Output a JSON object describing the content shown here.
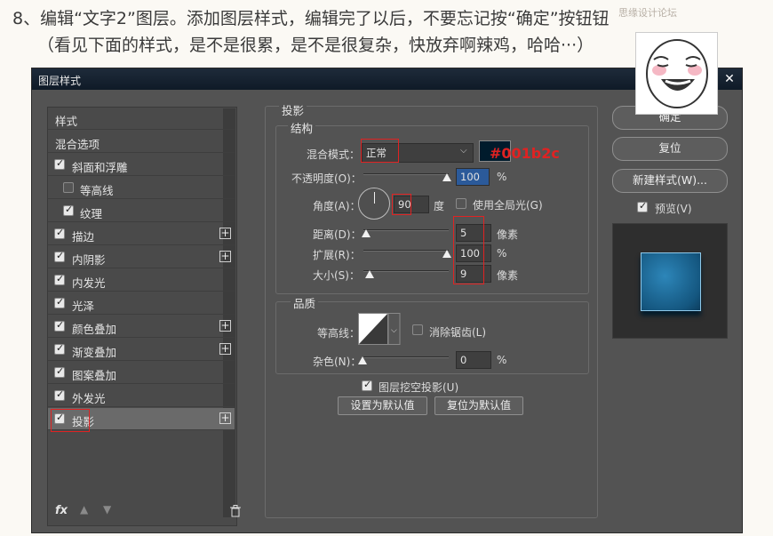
{
  "caption": {
    "line1": "8、编辑“文字2”图层。添加图层样式，编辑完了以后，不要忘记按“确定”按钮钮",
    "line2": "（看见下面的样式，是不是很累，是不是很复杂，快放弃啊辣鸡，哈哈···）",
    "watermark": "思缘设计论坛"
  },
  "dialog": {
    "title": "图层样式"
  },
  "styles_list": {
    "header": "样式",
    "blend_options": "混合选项",
    "items": [
      {
        "label": "斜面和浮雕",
        "checked": true
      },
      {
        "label": "等高线",
        "checked": false
      },
      {
        "label": "纹理",
        "checked": true
      },
      {
        "label": "描边",
        "checked": true
      },
      {
        "label": "内阴影",
        "checked": true
      },
      {
        "label": "内发光",
        "checked": true
      },
      {
        "label": "光泽",
        "checked": true
      },
      {
        "label": "颜色叠加",
        "checked": true
      },
      {
        "label": "渐变叠加",
        "checked": true
      },
      {
        "label": "图案叠加",
        "checked": true
      },
      {
        "label": "外发光",
        "checked": true
      },
      {
        "label": "投影",
        "checked": true
      }
    ],
    "fx_label": "fx"
  },
  "drop_shadow": {
    "title": "投影",
    "structure": "结构",
    "blend_mode_label": "混合模式：",
    "blend_mode_value": "正常",
    "color_annotation": "#001b2c",
    "color_hex": "#001b2c",
    "opacity_label": "不透明度(O)：",
    "opacity_value": "100",
    "opacity_unit": "%",
    "angle_label": "角度(A)：",
    "angle_value": "90",
    "angle_unit": "度",
    "global_light_label": "使用全局光(G)",
    "distance_label": "距离(D)：",
    "distance_value": "5",
    "distance_unit": "像素",
    "spread_label": "扩展(R)：",
    "spread_value": "100",
    "spread_unit": "%",
    "size_label": "大小(S)：",
    "size_value": "9",
    "size_unit": "像素",
    "quality": "品质",
    "contour_label": "等高线：",
    "antialias_label": "消除锯齿(L)",
    "noise_label": "杂色(N)：",
    "noise_value": "0",
    "noise_unit": "%",
    "knockout_label": "图层挖空投影(U)",
    "set_default": "设置为默认值",
    "reset_default": "复位为默认值"
  },
  "right": {
    "ok": "确定",
    "reset": "复位",
    "new_style": "新建样式(W)...",
    "preview": "预览(V)"
  }
}
